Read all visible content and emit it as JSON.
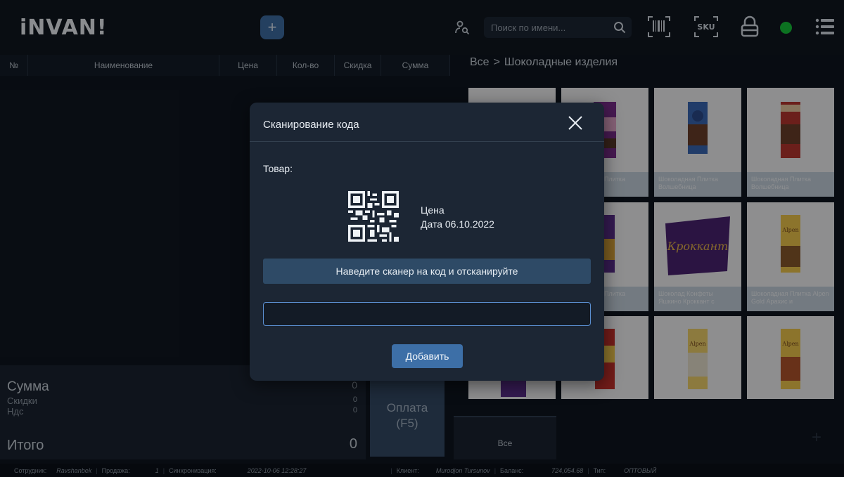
{
  "app": {
    "logo": "iNVAN!"
  },
  "header": {
    "add_label": "+",
    "search_placeholder": "Поиск по имени...",
    "status_color": "#16c43a",
    "icons": [
      "plus-icon",
      "user-search-icon",
      "search-icon",
      "barcode-icon",
      "sku-icon",
      "lock-icon",
      "status-dot",
      "menu-icon"
    ]
  },
  "order_table": {
    "columns": [
      "№",
      "Наименование",
      "Цена",
      "Кол-во",
      "Скидка",
      "Сумма"
    ]
  },
  "breadcrumb": {
    "root": "Все",
    "separator": ">",
    "current": "Шоколадные изделия"
  },
  "totals": {
    "sum_label": "Сумма",
    "sum_value": "0",
    "discount_label": "Скидки",
    "discount_value": "0",
    "vat_label": "Ндс",
    "vat_value": "0",
    "total_label": "Итого",
    "total_value": "0"
  },
  "pay_button": {
    "line1": "Оплата",
    "line2": "(F5)"
  },
  "products": [
    {
      "caption": ""
    },
    {
      "caption": "Шоколадная Плитка Волшебница"
    },
    {
      "caption": "Шоколадная Плитка Волшебница"
    },
    {
      "caption": "Шоколадная Плитка Волшебница"
    },
    {
      "caption": ""
    },
    {
      "caption": "Шоколадная Плитка Фундук и"
    },
    {
      "caption": "Шоколад Конфеты Яшкино Кроккант с"
    },
    {
      "caption": "Шоколадная Плитка Alpen Gold Арахис и"
    },
    {
      "caption": ""
    },
    {
      "caption": ""
    },
    {
      "caption": ""
    },
    {
      "caption": ""
    }
  ],
  "categories": {
    "all": "Все",
    "add": "+"
  },
  "statusbar": {
    "employee_label": "Сотрудник:",
    "employee": "Ravshanbek",
    "sale_label": "Продажа:",
    "sale": "1",
    "sync_label": "Синхронизация:",
    "sync": "2022-10-06 12:28:27",
    "client_label": "Клиент:",
    "client": "Murodjon Tursunov",
    "balance_label": "Баланс:",
    "balance": "724,054.68",
    "type_label": "Тип:",
    "type": "ОПТОВЫЙ"
  },
  "modal": {
    "title": "Сканирование кода",
    "item_label": "Товар:",
    "price_label": "Цена",
    "date_label": "Дата 06.10.2022",
    "hint": "Наведите сканер на код и отсканируйте",
    "input_value": "",
    "add_label": "Добавить"
  }
}
